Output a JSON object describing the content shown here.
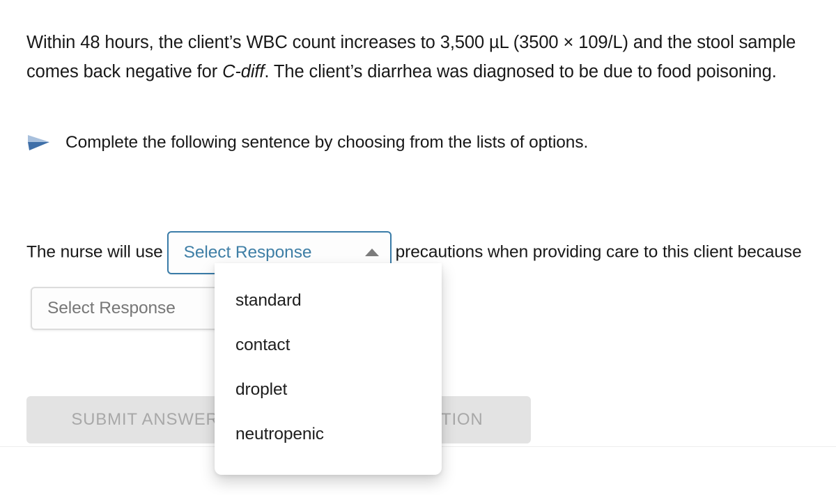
{
  "stem": {
    "text_part1": "Within 48 hours, the client’s WBC count increases to 3,500 µL (3500 × 109/L) and the stool sample comes back negative for ",
    "italic_term": "C-diff",
    "text_part2": ". The client’s diarrhea was diagnosed to be due to food poisoning."
  },
  "instruction": {
    "icon": "arrow-right-icon",
    "text": "Complete the following sentence by choosing from the lists of options."
  },
  "sentence": {
    "fragment_1": "The nurse will use",
    "fragment_2": "precautions when providing care to this client because",
    "fragment_3": "."
  },
  "dropdown_1": {
    "name": "response-select-1",
    "value": "Select Response",
    "state": "open",
    "caret_icon": "caret-up-icon",
    "options": [
      "standard",
      "contact",
      "droplet",
      "neutropenic"
    ]
  },
  "dropdown_2": {
    "name": "response-select-2",
    "value": "Select Response",
    "state": "closed",
    "caret_icon": "caret-down-icon"
  },
  "buttons": {
    "submit_label": "SUBMIT ANSWER",
    "explanation_label": "VIEW EXPLANATION"
  },
  "colors": {
    "select_border_active": "#3a7ca8",
    "select_text_active": "#3f7fa6",
    "button_bg": "#e3e3e3",
    "button_text": "#a8a8a8",
    "arrow_blue": "#3f6fa8",
    "arrow_blue_light": "#a8c0dd",
    "body_text": "#181818"
  }
}
